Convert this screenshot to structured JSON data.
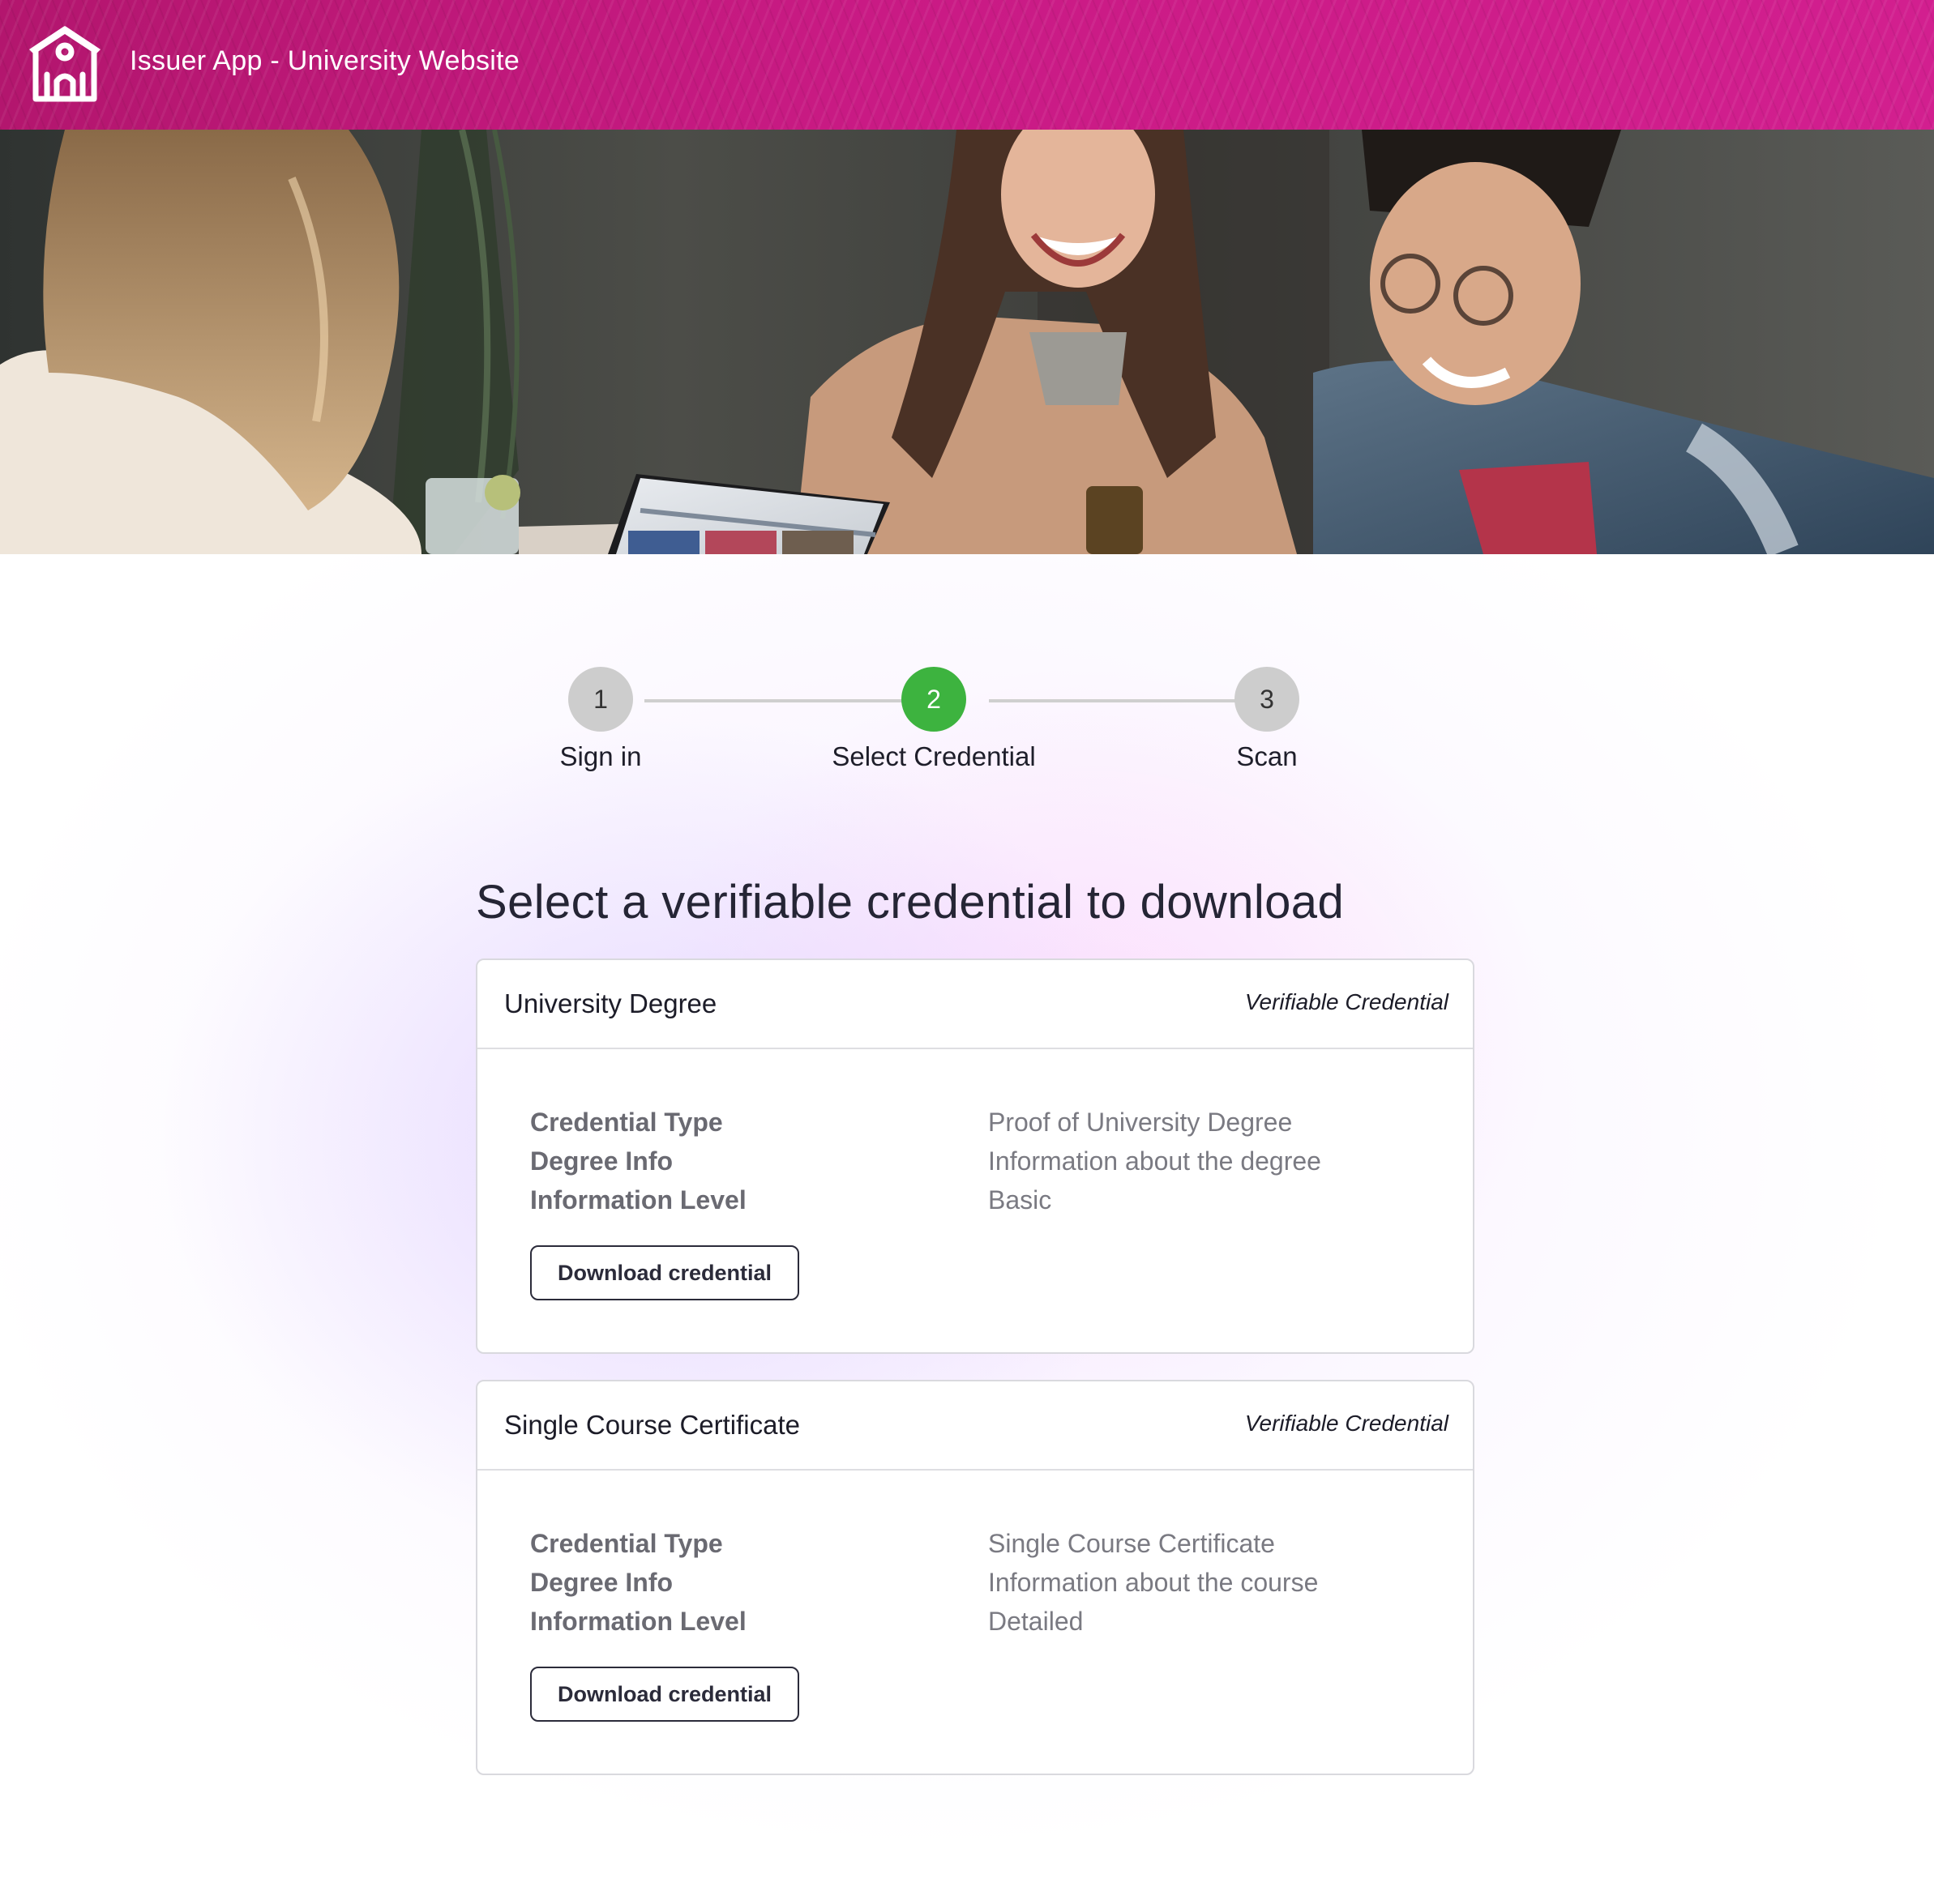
{
  "header": {
    "title": "Issuer App - University Website",
    "logo_icon": "school-building-icon",
    "background_color": "#c4177f"
  },
  "hero": {
    "image_icon": "hero-photo"
  },
  "stepper": {
    "steps": [
      {
        "number": "1",
        "label": "Sign in",
        "state": "inactive"
      },
      {
        "number": "2",
        "label": "Select Credential",
        "state": "active"
      },
      {
        "number": "3",
        "label": "Scan",
        "state": "inactive"
      }
    ],
    "active_color": "#3db33f",
    "inactive_color": "#cdcdcd"
  },
  "main": {
    "heading": "Select a verifiable credential to download"
  },
  "credentials": [
    {
      "title": "University Degree",
      "tag": "Verifiable Credential",
      "rows": [
        {
          "key": "Credential Type",
          "value": "Proof of University Degree"
        },
        {
          "key": "Degree Info",
          "value": "Information about the degree"
        },
        {
          "key": "Information Level",
          "value": "Basic"
        }
      ],
      "button_label": "Download credential"
    },
    {
      "title": "Single Course Certificate",
      "tag": "Verifiable Credential",
      "rows": [
        {
          "key": "Credential Type",
          "value": "Single Course Certificate"
        },
        {
          "key": "Degree Info",
          "value": "Information about the course"
        },
        {
          "key": "Information Level",
          "value": "Detailed"
        }
      ],
      "button_label": "Download credential"
    }
  ]
}
